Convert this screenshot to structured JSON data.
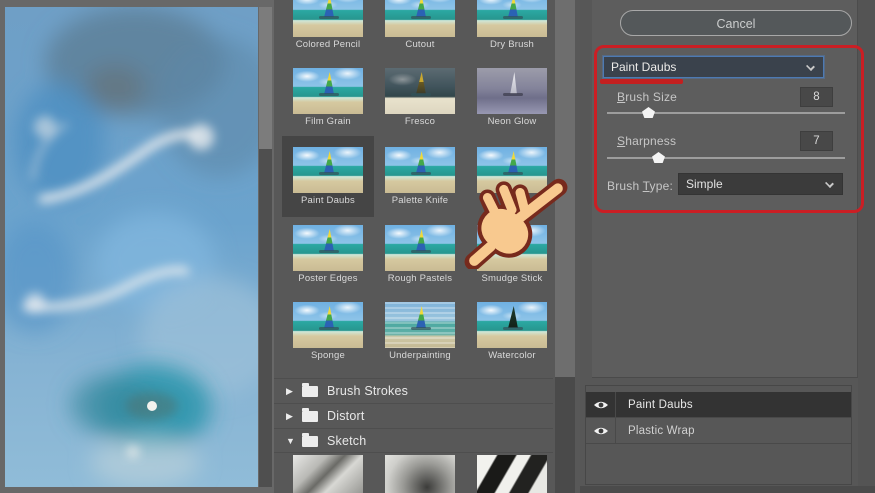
{
  "window": {
    "cancel_label": "Cancel"
  },
  "filter_settings": {
    "filter_select_value": "Paint Daubs",
    "brush_size": {
      "accel": "B",
      "rest": "rush Size",
      "value": "8"
    },
    "sharpness": {
      "accel": "S",
      "rest": "harpness",
      "value": "7"
    },
    "brush_type": {
      "pre": "Brush ",
      "accel": "T",
      "rest": "ype:",
      "value": "Simple"
    }
  },
  "filter_gallery": {
    "rows": [
      {
        "cells": [
          {
            "label": "Colored Pencil"
          },
          {
            "label": "Cutout"
          },
          {
            "label": "Dry Brush"
          }
        ]
      },
      {
        "cells": [
          {
            "label": "Film Grain"
          },
          {
            "label": "Fresco"
          },
          {
            "label": "Neon Glow"
          }
        ]
      },
      {
        "cells": [
          {
            "label": "Paint Daubs",
            "selected": true
          },
          {
            "label": "Palette Knife"
          },
          {
            "label": ""
          }
        ]
      },
      {
        "cells": [
          {
            "label": "Poster Edges"
          },
          {
            "label": "Rough Pastels"
          },
          {
            "label": "Smudge Stick"
          }
        ]
      },
      {
        "cells": [
          {
            "label": "Sponge"
          },
          {
            "label": "Underpainting"
          },
          {
            "label": "Watercolor"
          }
        ]
      }
    ],
    "folders": [
      {
        "glyph": "▶",
        "name": "Brush Strokes",
        "expanded": false
      },
      {
        "glyph": "▶",
        "name": "Distort",
        "expanded": false
      },
      {
        "glyph": "▼",
        "name": "Sketch",
        "expanded": true
      }
    ]
  },
  "effect_layers": {
    "rows": [
      {
        "name": "Paint Daubs",
        "visible": true,
        "selected": true
      },
      {
        "name": "Plastic Wrap",
        "visible": true,
        "selected": false
      }
    ]
  },
  "colors": {
    "annotation_red": "#cb1e24",
    "dropdown_focus_blue": "#4d7ab3",
    "panel_gray": "#5d5d5d"
  }
}
